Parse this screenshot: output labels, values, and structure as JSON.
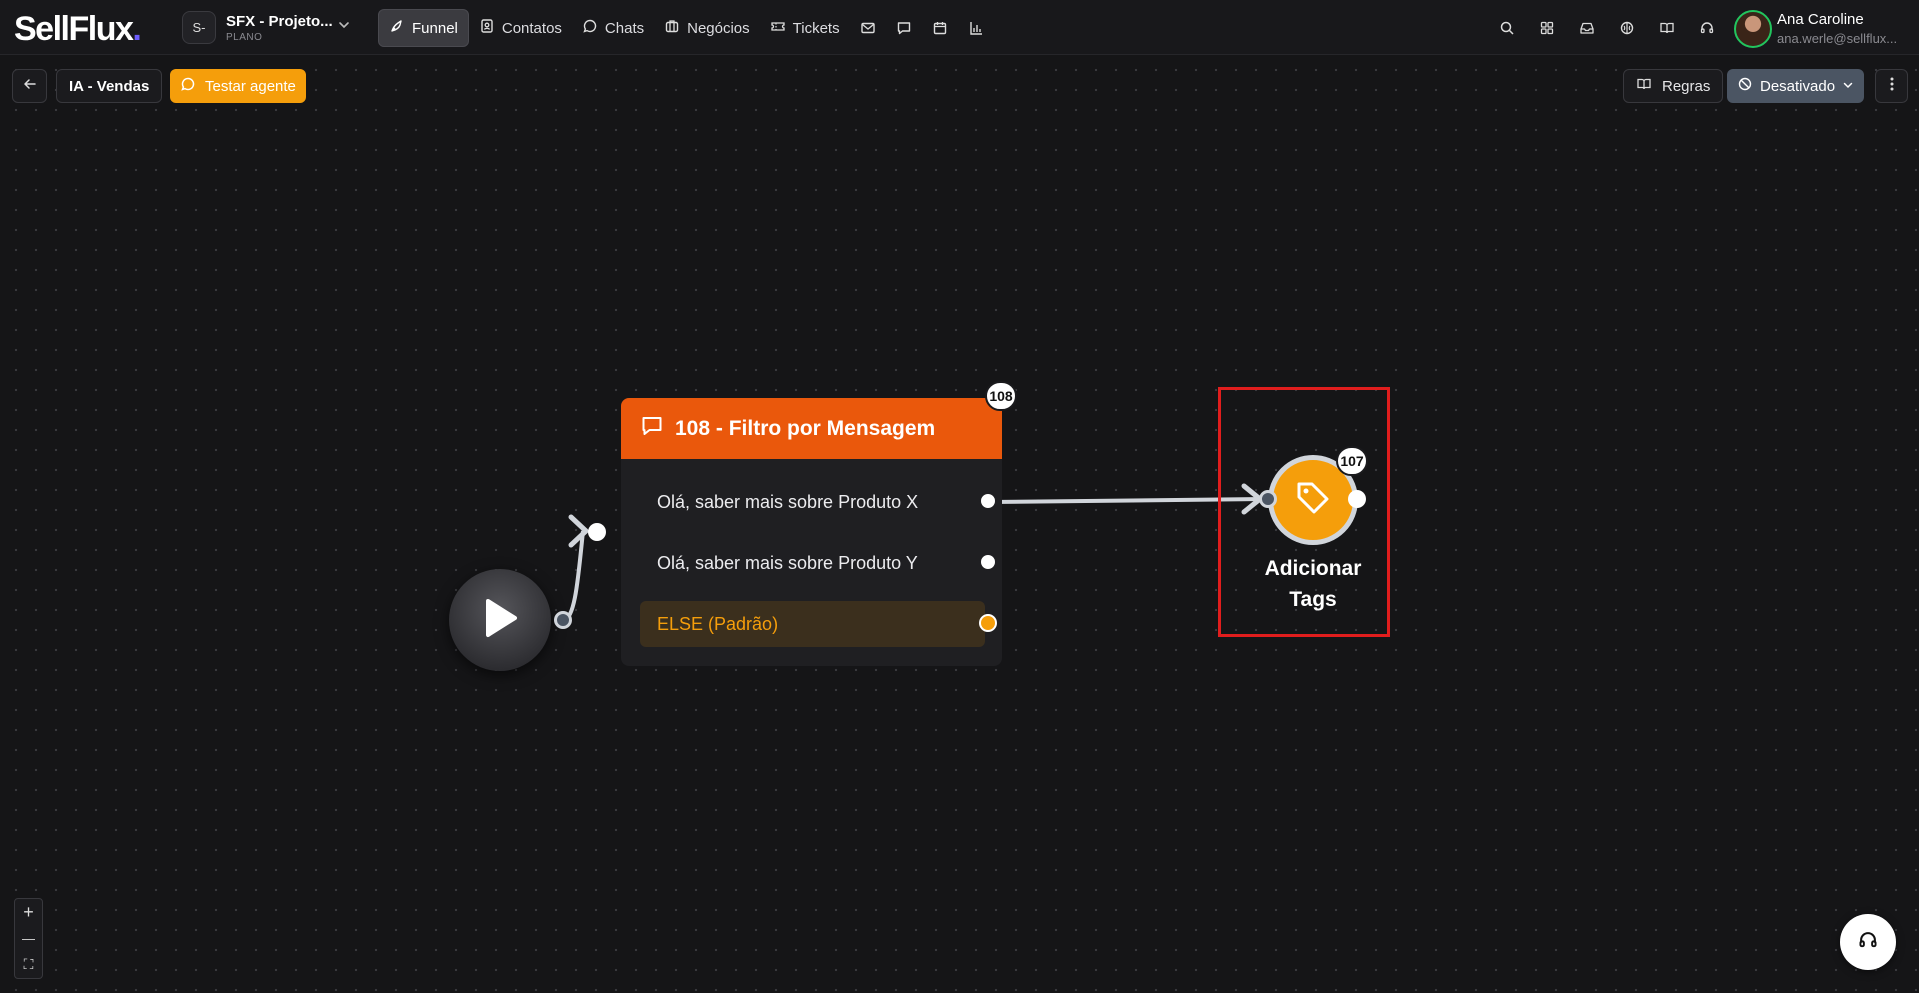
{
  "app": {
    "logo_text": "SellFlux",
    "logo_dot": "."
  },
  "project": {
    "badge": "S-",
    "name": "SFX - Projeto...",
    "plan": "PLANO"
  },
  "nav": {
    "funnel": "Funnel",
    "contacts": "Contatos",
    "chats": "Chats",
    "deals": "Negócios",
    "tickets": "Tickets"
  },
  "user": {
    "name": "Ana Caroline",
    "email": "ana.werle@sellflux..."
  },
  "toolbar": {
    "agent_name": "IA - Vendas",
    "test_label": "Testar agente",
    "rules_label": "Regras",
    "status_label": "Desativado"
  },
  "flow": {
    "filter_node": {
      "badge": "108",
      "title": "108 - Filtro por Mensagem",
      "options": [
        "Olá, saber mais sobre Produto X",
        "Olá, saber mais sobre Produto Y",
        "ELSE (Padrão)"
      ]
    },
    "tag_node": {
      "badge": "107",
      "label": "Adicionar Tags"
    }
  },
  "zoom": {
    "in": "+",
    "out": "—",
    "fit": "⛶"
  },
  "colors": {
    "accent_orange": "#ea580c",
    "amber": "#f59e0b",
    "status_gray": "#4b5563",
    "selection_red": "#e11d1d"
  }
}
